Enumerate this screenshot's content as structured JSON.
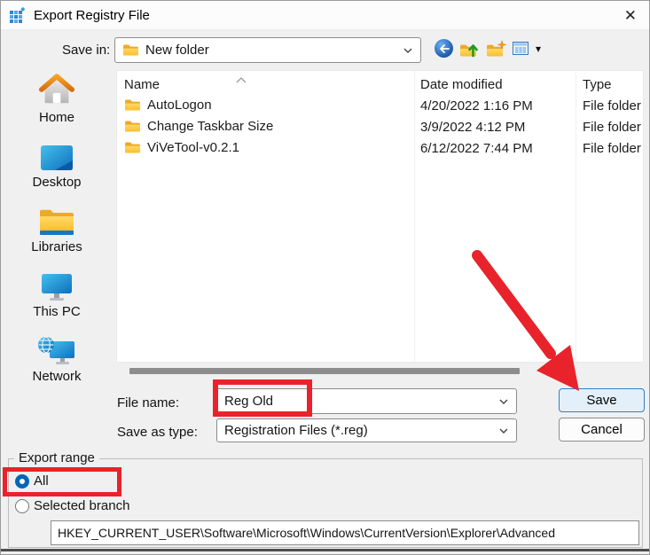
{
  "window": {
    "title": "Export Registry File",
    "close_glyph": "✕"
  },
  "save_in": {
    "label": "Save in:",
    "value": "New folder"
  },
  "toolbar": {
    "icons": [
      {
        "name": "back-icon"
      },
      {
        "name": "up-one-level-icon"
      },
      {
        "name": "create-new-folder-icon"
      },
      {
        "name": "view-menu-icon"
      }
    ],
    "view_caret_glyph": "▾"
  },
  "sidebar": {
    "items": [
      {
        "label": "Home",
        "icon": "home-icon"
      },
      {
        "label": "Desktop",
        "icon": "desktop-icon"
      },
      {
        "label": "Libraries",
        "icon": "libraries-icon"
      },
      {
        "label": "This PC",
        "icon": "this-pc-icon"
      },
      {
        "label": "Network",
        "icon": "network-icon"
      }
    ]
  },
  "file_list": {
    "columns": [
      "Name",
      "Date modified",
      "Type"
    ],
    "sort_column": "Name",
    "sort_direction": "ascending",
    "rows": [
      {
        "name": "AutoLogon",
        "date_modified": "4/20/2022 1:16 PM",
        "type": "File folder",
        "icon": "folder-icon"
      },
      {
        "name": "Change Taskbar Size",
        "date_modified": "3/9/2022 4:12 PM",
        "type": "File folder",
        "icon": "folder-icon"
      },
      {
        "name": "ViVeTool-v0.2.1",
        "date_modified": "6/12/2022 7:44 PM",
        "type": "File folder",
        "icon": "folder-icon"
      }
    ]
  },
  "file_name": {
    "label": "File name:",
    "value": "Reg Old"
  },
  "save_as_type": {
    "label": "Save as type:",
    "value": "Registration Files (*.reg)"
  },
  "buttons": {
    "save": "Save",
    "cancel": "Cancel"
  },
  "export_range": {
    "label": "Export range",
    "options": [
      {
        "label": "All",
        "selected": true
      },
      {
        "label": "Selected branch",
        "selected": false
      }
    ],
    "branch_path": "HKEY_CURRENT_USER\\Software\\Microsoft\\Windows\\CurrentVersion\\Explorer\\Advanced"
  },
  "annotations": {
    "highlight_file_name_box": true,
    "highlight_all_radio_box": true,
    "arrow_to_save_button": true
  },
  "colors": {
    "annotation_red": "#e8232b",
    "accent_blue": "#0066b8",
    "save_button_fill": "#e3f0fa",
    "dialog_background": "#f0f0f0"
  }
}
